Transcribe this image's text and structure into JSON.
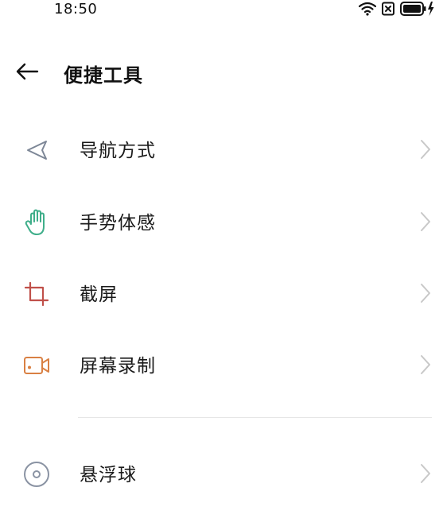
{
  "status_bar": {
    "time": "18:50",
    "icons": [
      "wifi-icon",
      "sim-disabled-icon",
      "battery-charging-icon"
    ]
  },
  "header": {
    "title": "便捷工具",
    "back_icon": "arrow-left-icon"
  },
  "menu": {
    "items": [
      {
        "label": "导航方式",
        "icon": "navigation-triangle-icon",
        "icon_color": "#7d8797"
      },
      {
        "label": "手势体感",
        "icon": "hand-gesture-icon",
        "icon_color": "#3fae8a"
      },
      {
        "label": "截屏",
        "icon": "crop-icon",
        "icon_color": "#c0504a"
      },
      {
        "label": "屏幕录制",
        "icon": "video-camera-icon",
        "icon_color": "#d98043"
      },
      {
        "label": "悬浮球",
        "icon": "floating-ball-icon",
        "icon_color": "#8a93a3"
      }
    ]
  },
  "colors": {
    "chevron": "#c8c8c8",
    "divider": "#e6e6e6"
  }
}
